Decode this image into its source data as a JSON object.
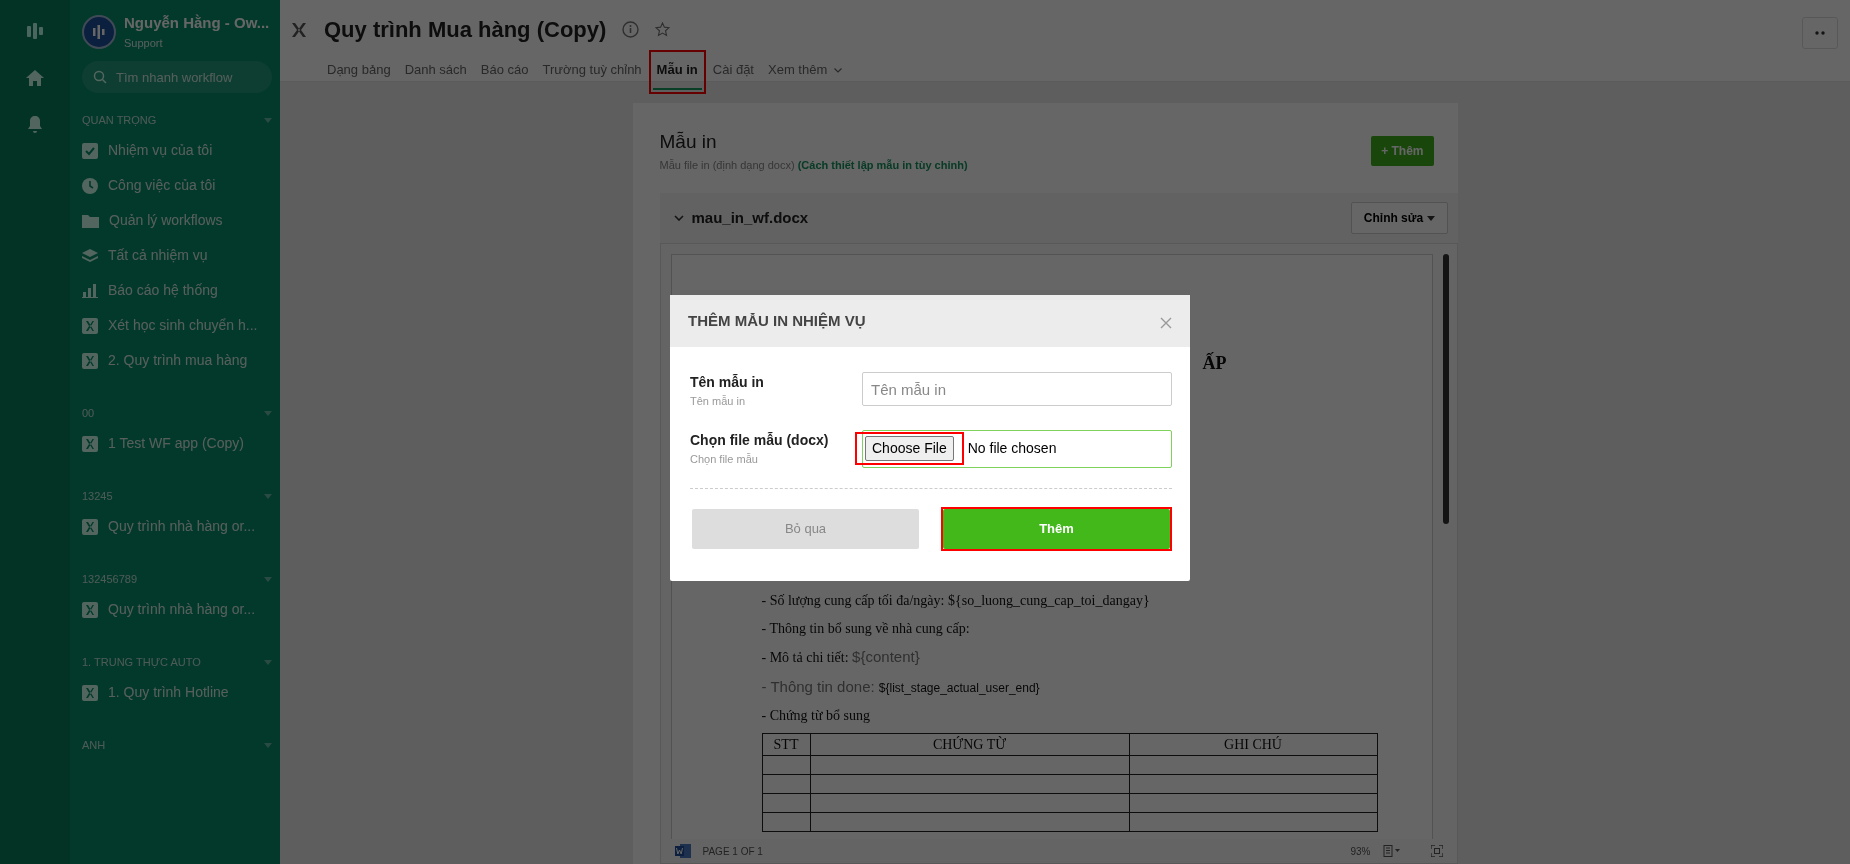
{
  "workspace": {
    "name": "Nguyễn Hằng - Ow...",
    "role": "Support"
  },
  "search": {
    "placeholder": "Tìm nhanh workflow"
  },
  "sections": [
    {
      "title": "QUAN TRỌNG",
      "items": [
        {
          "label": "Nhiệm vụ của tôi",
          "kind": "check"
        },
        {
          "label": "Công việc của tôi",
          "kind": "clock"
        },
        {
          "label": "Quản lý workflows",
          "kind": "folder"
        },
        {
          "label": "Tất cả nhiệm vụ",
          "kind": "layers"
        },
        {
          "label": "Báo cáo hệ thống",
          "kind": "chart"
        },
        {
          "label": "Xét học sinh chuyển h...",
          "kind": "workflow"
        },
        {
          "label": "2. Quy trình mua hàng",
          "kind": "workflow"
        }
      ]
    },
    {
      "title": "00",
      "items": [
        {
          "label": "1 Test WF app (Copy)",
          "kind": "workflow"
        }
      ]
    },
    {
      "title": "13245",
      "items": [
        {
          "label": "Quy trình nhà hàng or...",
          "kind": "workflow"
        }
      ]
    },
    {
      "title": "132456789",
      "items": [
        {
          "label": "Quy trình nhà hàng or...",
          "kind": "workflow"
        }
      ]
    },
    {
      "title": "1. TRUNG THỰC AUTO",
      "items": [
        {
          "label": "1. Quy trình Hotline",
          "kind": "workflow"
        }
      ]
    },
    {
      "title": "ANH"
    }
  ],
  "header": {
    "title": "Quy trình Mua hàng (Copy)",
    "tabs": [
      {
        "label": "Dạng bảng",
        "selected": false,
        "highlighted": false
      },
      {
        "label": "Danh sách",
        "selected": false,
        "highlighted": false
      },
      {
        "label": "Báo cáo",
        "selected": false,
        "highlighted": false
      },
      {
        "label": "Trường tuỳ chỉnh",
        "selected": false,
        "highlighted": false
      },
      {
        "label": "Mẫu in",
        "selected": true,
        "highlighted": true
      },
      {
        "label": "Cài đặt",
        "selected": false,
        "highlighted": false
      },
      {
        "label": "Xem thêm",
        "selected": false,
        "highlighted": false,
        "kind": "dropdown"
      }
    ]
  },
  "card": {
    "title": "Mẫu in",
    "subtitle": "Mẫu file in (định dạng docx) **(Cách thiết lập mẫu in tùy chỉnh)**",
    "add_button": "+ Thêm",
    "template": {
      "file": "mau_in_wf.docx",
      "expanded": true,
      "edit_button": "Chỉnh sửa",
      "document": {
        "title_fragment": "ẤP",
        "lines": [
          {
            "parts": [
              {
                "text": "- Số lượng cung cấp tối đa/ngày: ",
                "kind": "serif"
              },
              {
                "text": "${so_luong_cung_cap_toi_dangay}",
                "kind": "serif"
              }
            ]
          },
          {
            "parts": [
              {
                "text": "- Thông tin bổ sung về nhà cung cấp:",
                "kind": "serif"
              }
            ]
          },
          {
            "parts": [
              {
                "text": "- Mô tả chi tiết: ",
                "kind": "serif"
              },
              {
                "text": "${content}",
                "kind": "grey"
              }
            ]
          },
          {
            "parts": [
              {
                "text": "- Thông tin done: ",
                "kind": "grey"
              },
              {
                "text": "${list_stage_actual_user_end}",
                "kind": "small"
              }
            ]
          },
          {
            "parts": [
              {
                "text": "- Chứng từ bổ sung",
                "kind": "serif"
              }
            ]
          }
        ],
        "table": {
          "columns": [
            "STT",
            "CHỨNG TỪ",
            "GHI CHÚ"
          ]
        }
      },
      "status": {
        "page": "PAGE 1 OF 1",
        "zoom": "93%"
      }
    }
  },
  "modal": {
    "title": "THÊM MẪU IN NHIỆM VỤ",
    "fields": [
      {
        "kind": "text",
        "label": "Tên mẫu in",
        "hint": "Tên mẫu in",
        "placeholder": "Tên mẫu in",
        "highlighted": false
      },
      {
        "kind": "file",
        "label": "Chọn file mẫu (docx)",
        "hint": "Chọn file mẫu",
        "button": "Choose File",
        "status": "No file chosen",
        "highlighted": true
      }
    ],
    "buttons": [
      {
        "label": "Bỏ qua",
        "kind": "secondary",
        "highlighted": false
      },
      {
        "label": "Thêm",
        "kind": "primary",
        "highlighted": true
      }
    ]
  }
}
